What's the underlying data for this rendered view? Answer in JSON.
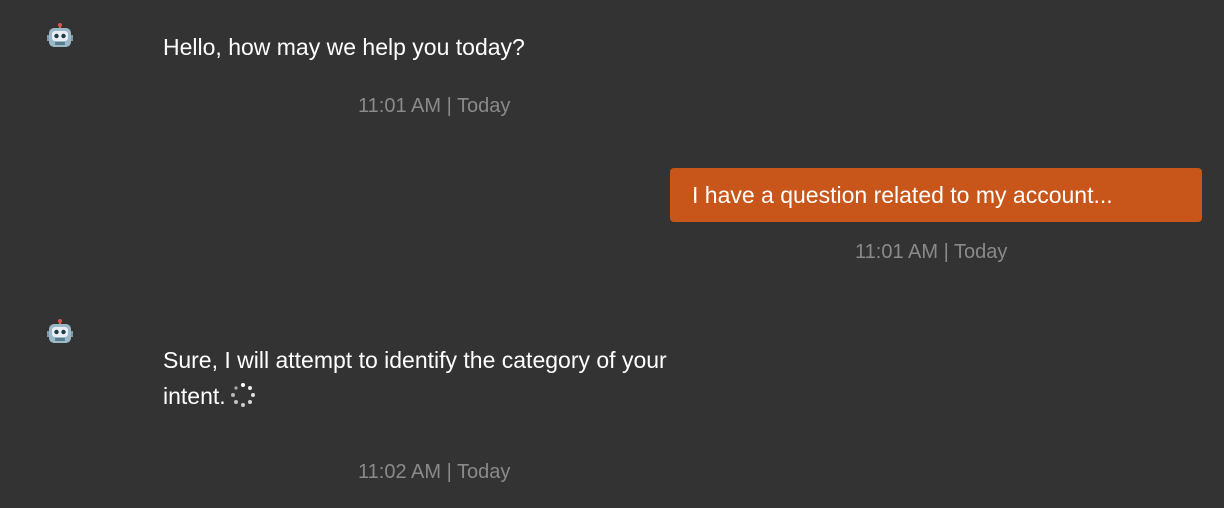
{
  "messages": [
    {
      "sender": "bot",
      "avatar_icon": "robot-icon",
      "text": "Hello, how may we help you today?",
      "timestamp": "11:01 AM | Today"
    },
    {
      "sender": "user",
      "text": "I have a question related to my account...",
      "timestamp": "11:01 AM | Today",
      "bubble_color": "#c8561b"
    },
    {
      "sender": "bot",
      "avatar_icon": "robot-icon",
      "text_line1": "Sure, I will attempt to identify the category of your",
      "text_line2": "intent.",
      "status_icon": "loading-spinner-icon",
      "timestamp": "11:02 AM | Today"
    }
  ],
  "colors": {
    "background": "#333333",
    "text": "#ffffff",
    "timestamp": "#8a8a8a",
    "user_bubble": "#c8561b"
  }
}
